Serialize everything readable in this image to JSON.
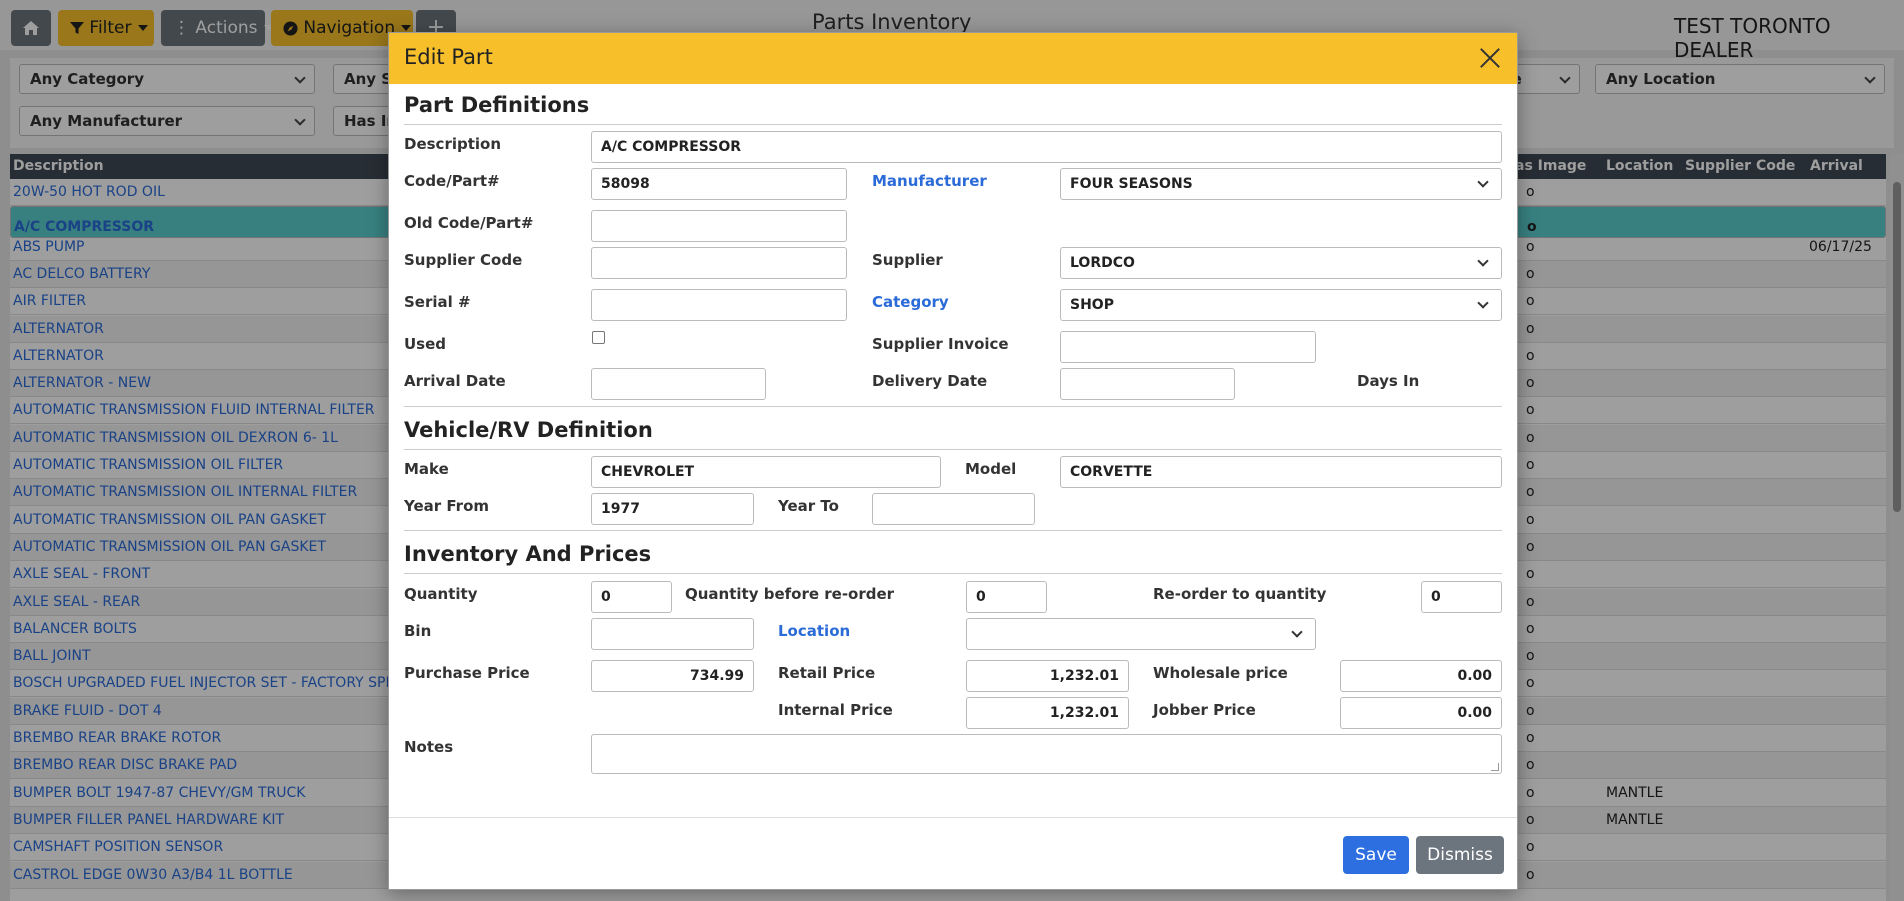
{
  "topbar": {
    "filter_label": "Filter",
    "actions_label": "Actions",
    "navigation_label": "Navigation",
    "title": "Parts Inventory",
    "dealer": "TEST TORONTO DEALER"
  },
  "filters": {
    "category": "Any Category",
    "supplier_partial": "Any S",
    "manufacturer": "Any Manufacturer",
    "image_partial": "Has In",
    "partial_right": "ne",
    "location": "Any Location"
  },
  "grid": {
    "columns": {
      "description": "Description",
      "has_image": "as Image",
      "location": "Location",
      "supplier_code": "Supplier Code",
      "arrival": "Arrival"
    },
    "rows": [
      {
        "desc": "20W-50 HOT ROD OIL",
        "img": "o",
        "loc": "",
        "arr": ""
      },
      {
        "desc": "A/C COMPRESSOR",
        "img": "o",
        "loc": "",
        "arr": ""
      },
      {
        "desc": "ABS PUMP",
        "img": "o",
        "loc": "",
        "arr": "06/17/25"
      },
      {
        "desc": "AC DELCO BATTERY",
        "img": "o",
        "loc": "",
        "arr": ""
      },
      {
        "desc": "AIR FILTER",
        "img": "o",
        "loc": "",
        "arr": ""
      },
      {
        "desc": "ALTERNATOR",
        "img": "o",
        "loc": "",
        "arr": ""
      },
      {
        "desc": "ALTERNATOR",
        "img": "o",
        "loc": "",
        "arr": ""
      },
      {
        "desc": "ALTERNATOR - NEW",
        "img": "o",
        "loc": "",
        "arr": ""
      },
      {
        "desc": "AUTOMATIC TRANSMISSION FLUID INTERNAL FILTER",
        "img": "o",
        "loc": "",
        "arr": ""
      },
      {
        "desc": "AUTOMATIC TRANSMISSION OIL DEXRON 6- 1L",
        "img": "o",
        "loc": "",
        "arr": ""
      },
      {
        "desc": "AUTOMATIC TRANSMISSION OIL FILTER",
        "img": "o",
        "loc": "",
        "arr": ""
      },
      {
        "desc": "AUTOMATIC TRANSMISSION OIL INTERNAL FILTER",
        "img": "o",
        "loc": "",
        "arr": ""
      },
      {
        "desc": "AUTOMATIC TRANSMISSION OIL PAN GASKET",
        "img": "o",
        "loc": "",
        "arr": ""
      },
      {
        "desc": "AUTOMATIC TRANSMISSION OIL PAN GASKET",
        "img": "o",
        "loc": "",
        "arr": ""
      },
      {
        "desc": "AXLE SEAL - FRONT",
        "img": "o",
        "loc": "",
        "arr": ""
      },
      {
        "desc": "AXLE SEAL - REAR",
        "img": "o",
        "loc": "",
        "arr": ""
      },
      {
        "desc": "BALANCER BOLTS",
        "img": "o",
        "loc": "",
        "arr": ""
      },
      {
        "desc": "BALL JOINT",
        "img": "o",
        "loc": "",
        "arr": ""
      },
      {
        "desc": "BOSCH UPGRADED FUEL INJECTOR SET - FACTORY SPEC",
        "img": "o",
        "loc": "",
        "arr": ""
      },
      {
        "desc": "BRAKE FLUID - DOT 4",
        "img": "o",
        "loc": "",
        "arr": ""
      },
      {
        "desc": "BREMBO REAR BRAKE ROTOR",
        "img": "o",
        "loc": "",
        "arr": ""
      },
      {
        "desc": "BREMBO REAR DISC BRAKE PAD",
        "img": "o",
        "loc": "",
        "arr": ""
      },
      {
        "desc": "BUMPER BOLT 1947-87 CHEVY/GM TRUCK",
        "img": "o",
        "loc": "MANTLE",
        "arr": ""
      },
      {
        "desc": "BUMPER FILLER PANEL HARDWARE KIT",
        "img": "o",
        "loc": "MANTLE",
        "arr": ""
      },
      {
        "desc": "CAMSHAFT POSITION SENSOR",
        "img": "o",
        "loc": "",
        "arr": ""
      },
      {
        "desc": "CASTROL EDGE 0W30 A3/B4 1L BOTTLE",
        "img": "o",
        "loc": "",
        "arr": ""
      }
    ]
  },
  "modal": {
    "title": "Edit Part",
    "sections": {
      "part_definitions": "Part Definitions",
      "vehicle": "Vehicle/RV Definition",
      "inventory": "Inventory And Prices"
    },
    "labels": {
      "description": "Description",
      "code": "Code/Part#",
      "manufacturer": "Manufacturer",
      "old_code": "Old Code/Part#",
      "supplier_code": "Supplier Code",
      "supplier": "Supplier",
      "serial": "Serial #",
      "category": "Category",
      "used": "Used",
      "supplier_invoice": "Supplier Invoice",
      "arrival_date": "Arrival Date",
      "delivery_date": "Delivery Date",
      "days_in": "Days In",
      "make": "Make",
      "model": "Model",
      "year_from": "Year From",
      "year_to": "Year To",
      "quantity": "Quantity",
      "qty_before_reorder": "Quantity before re-order",
      "reorder_to_qty": "Re-order to quantity",
      "bin": "Bin",
      "location": "Location",
      "purchase_price": "Purchase Price",
      "retail_price": "Retail Price",
      "wholesale_price": "Wholesale price",
      "internal_price": "Internal Price",
      "jobber_price": "Jobber Price",
      "notes": "Notes"
    },
    "values": {
      "description": "A/C COMPRESSOR",
      "code": "58098",
      "manufacturer": "FOUR SEASONS",
      "old_code": "",
      "supplier_code": "",
      "supplier": "LORDCO",
      "serial": "",
      "category": "SHOP",
      "used": false,
      "supplier_invoice": "",
      "arrival_date": "",
      "delivery_date": "",
      "make": "CHEVROLET",
      "model": "CORVETTE",
      "year_from": "1977",
      "year_to": "",
      "quantity": "0",
      "qty_before_reorder": "0",
      "reorder_to_qty": "0",
      "bin": "",
      "location": "",
      "purchase_price": "734.99",
      "retail_price": "1,232.01",
      "wholesale_price": "0.00",
      "internal_price": "1,232.01",
      "jobber_price": "0.00",
      "notes": ""
    },
    "buttons": {
      "save": "Save",
      "dismiss": "Dismiss"
    }
  },
  "colors": {
    "header": "#f7c02b",
    "link": "#2a6bd8",
    "primary": "#2d6fe0",
    "secondary": "#6c757d",
    "selected_row": "#5bcfcf"
  }
}
